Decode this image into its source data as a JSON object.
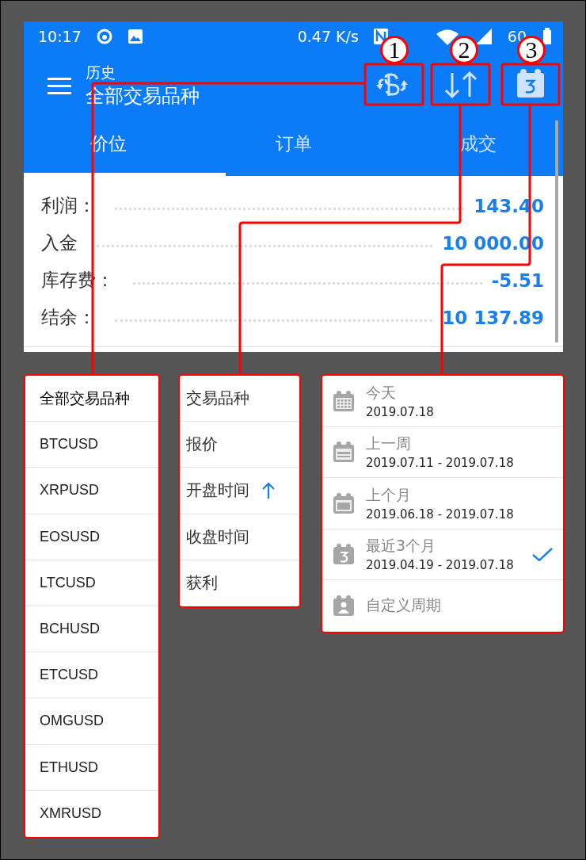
{
  "status_bar": {
    "time": "10:17",
    "speed": "0.47 K/s",
    "battery": "60"
  },
  "toolbar": {
    "subtitle": "历史",
    "title": "全部交易品种"
  },
  "tabs": [
    {
      "label": "价位",
      "selected": true
    },
    {
      "label": "订单",
      "selected": false
    },
    {
      "label": "成交",
      "selected": false
    }
  ],
  "summary": [
    {
      "label": "利润：",
      "value": "143.40"
    },
    {
      "label": "入金",
      "value": "10 000.00"
    },
    {
      "label": "库存费：",
      "value": "-5.51"
    },
    {
      "label": "结余：",
      "value": "10 137.89"
    }
  ],
  "callouts": [
    "1",
    "2",
    "3"
  ],
  "symbol_menu": [
    {
      "label": "全部交易品种",
      "selected": true
    },
    {
      "label": "BTCUSD",
      "selected": false
    },
    {
      "label": "XRPUSD",
      "selected": false
    },
    {
      "label": "EOSUSD",
      "selected": false
    },
    {
      "label": "LTCUSD",
      "selected": false
    },
    {
      "label": "BCHUSD",
      "selected": false
    },
    {
      "label": "ETCUSD",
      "selected": false
    },
    {
      "label": "OMGUSD",
      "selected": false
    },
    {
      "label": "ETHUSD",
      "selected": false
    },
    {
      "label": "XMRUSD",
      "selected": false
    }
  ],
  "sort_menu": [
    {
      "label": "交易品种",
      "sorted_ascending": false
    },
    {
      "label": "报价",
      "sorted_ascending": false
    },
    {
      "label": "开盘时间",
      "sorted_ascending": true
    },
    {
      "label": "收盘时间",
      "sorted_ascending": false
    },
    {
      "label": "获利",
      "sorted_ascending": false
    }
  ],
  "period_menu": [
    {
      "kind": "day",
      "label": "今天",
      "range": "2019.07.18",
      "selected": false
    },
    {
      "kind": "week",
      "label": "上一周",
      "range": "2019.07.11 - 2019.07.18",
      "selected": false
    },
    {
      "kind": "month",
      "label": "上个月",
      "range": "2019.06.18 - 2019.07.18",
      "selected": false
    },
    {
      "kind": "quarter",
      "label": "最近3个月",
      "range": "2019.04.19 - 2019.07.18",
      "selected": true
    },
    {
      "kind": "custom",
      "label": "自定义周期",
      "selected": false
    }
  ]
}
